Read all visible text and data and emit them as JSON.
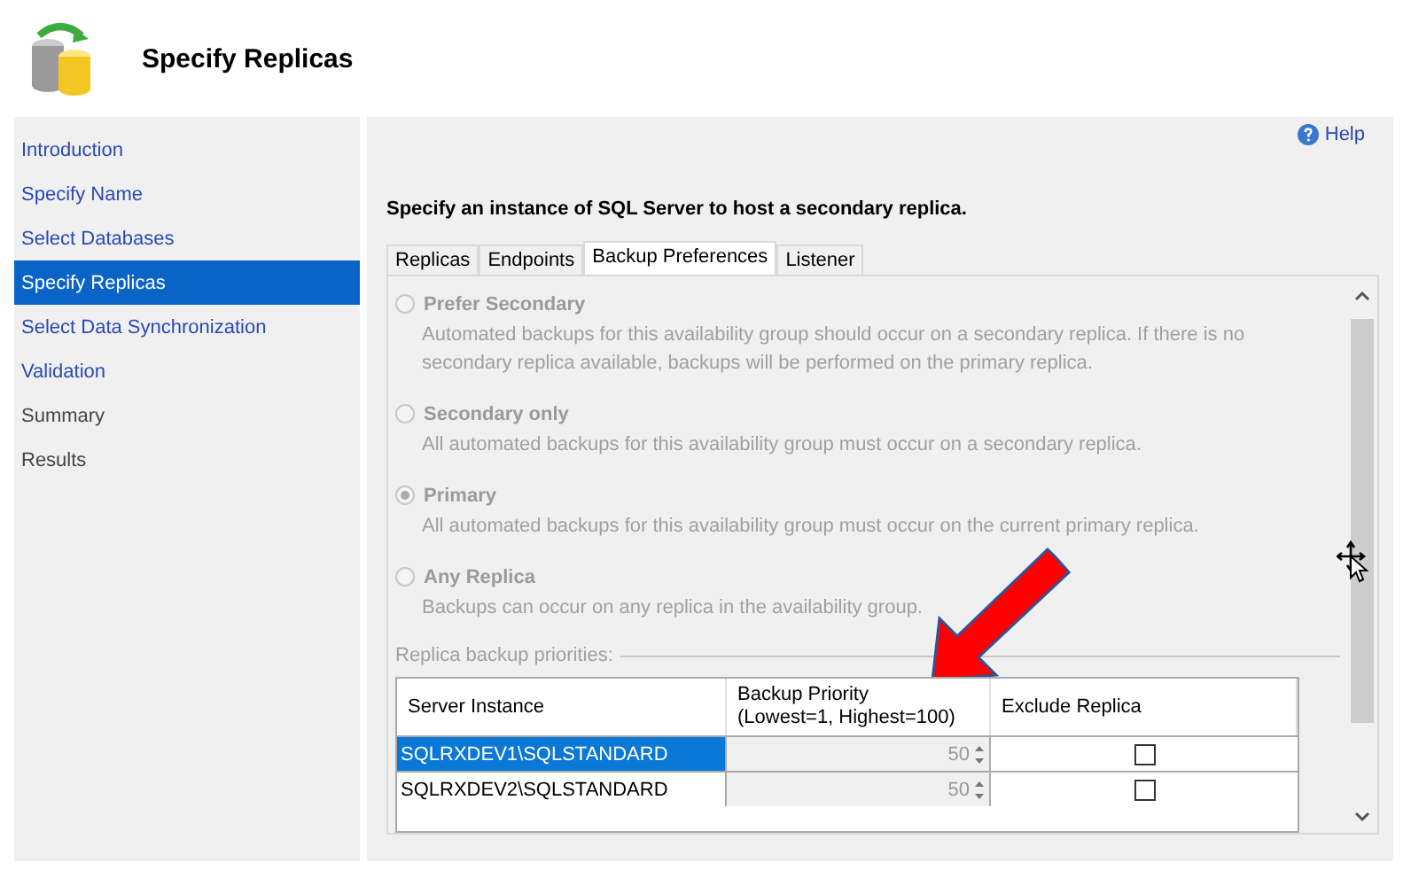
{
  "header": {
    "title": "Specify Replicas"
  },
  "sidebar": {
    "items": [
      {
        "label": "Introduction",
        "selected": false,
        "enabled": true
      },
      {
        "label": "Specify Name",
        "selected": false,
        "enabled": true
      },
      {
        "label": "Select Databases",
        "selected": false,
        "enabled": true
      },
      {
        "label": "Specify Replicas",
        "selected": true,
        "enabled": true
      },
      {
        "label": "Select Data Synchronization",
        "selected": false,
        "enabled": true
      },
      {
        "label": "Validation",
        "selected": false,
        "enabled": true
      },
      {
        "label": "Summary",
        "selected": false,
        "enabled": false
      },
      {
        "label": "Results",
        "selected": false,
        "enabled": false
      }
    ]
  },
  "help": {
    "label": "Help"
  },
  "heading": "Specify an instance of SQL Server to host a secondary replica.",
  "tabs": [
    {
      "label": "Replicas",
      "selected": false
    },
    {
      "label": "Endpoints",
      "selected": false
    },
    {
      "label": "Backup Preferences",
      "selected": true
    },
    {
      "label": "Listener",
      "selected": false
    }
  ],
  "options": [
    {
      "label": "Prefer Secondary",
      "description": "Automated backups for this availability group should occur on a secondary replica. If there is no secondary replica available, backups will be performed on the primary replica.",
      "selected": false
    },
    {
      "label": "Secondary only",
      "description": "All automated backups for this availability group must occur on a secondary replica.",
      "selected": false
    },
    {
      "label": "Primary",
      "description": "All automated backups for this availability group must occur on the current primary replica.",
      "selected": true
    },
    {
      "label": "Any Replica",
      "description": "Backups can occur on any replica in the availability group.",
      "selected": false
    }
  ],
  "priorities": {
    "title": "Replica backup priorities:",
    "columns": [
      "Server Instance",
      "Backup Priority\n(Lowest=1, Highest=100)",
      "Exclude Replica"
    ],
    "rows": [
      {
        "server": "SQLRXDEV1\\SQLSTANDARD",
        "priority": "50",
        "exclude": false,
        "selected": true
      },
      {
        "server": "SQLRXDEV2\\SQLSTANDARD",
        "priority": "50",
        "exclude": false,
        "selected": false
      }
    ]
  }
}
